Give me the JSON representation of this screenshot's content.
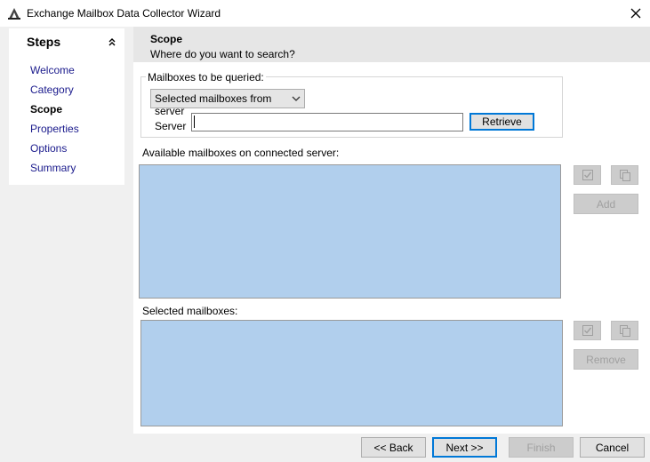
{
  "window": {
    "title": "Exchange Mailbox Data Collector Wizard"
  },
  "steps": {
    "title": "Steps",
    "items": [
      {
        "label": "Welcome"
      },
      {
        "label": "Category"
      },
      {
        "label": "Scope"
      },
      {
        "label": "Properties"
      },
      {
        "label": "Options"
      },
      {
        "label": "Summary"
      }
    ],
    "active": "Scope"
  },
  "header": {
    "title": "Scope",
    "subtitle": "Where do you want to search?"
  },
  "query": {
    "group_label": "Mailboxes to be queried:",
    "selected_option": "Selected mailboxes from server",
    "server_label": "Server",
    "server_value": "",
    "retrieve_label": "Retrieve"
  },
  "available": {
    "label": "Available mailboxes on connected server:",
    "add_label": "Add",
    "items": []
  },
  "selected": {
    "label": "Selected mailboxes:",
    "remove_label": "Remove",
    "items": []
  },
  "footer": {
    "back_label": "<< Back",
    "next_label": "Next >>",
    "finish_label": "Finish",
    "cancel_label": "Cancel"
  },
  "colors": {
    "list_background": "#b1cfed",
    "primary_border": "#0078d7"
  },
  "icons": {
    "app": "wizard-app-icon",
    "close": "close-icon",
    "collapse": "double-chevron-up-icon",
    "check_all": "check-all-icon",
    "copy": "copy-icon",
    "dropdown": "chevron-down-icon"
  }
}
